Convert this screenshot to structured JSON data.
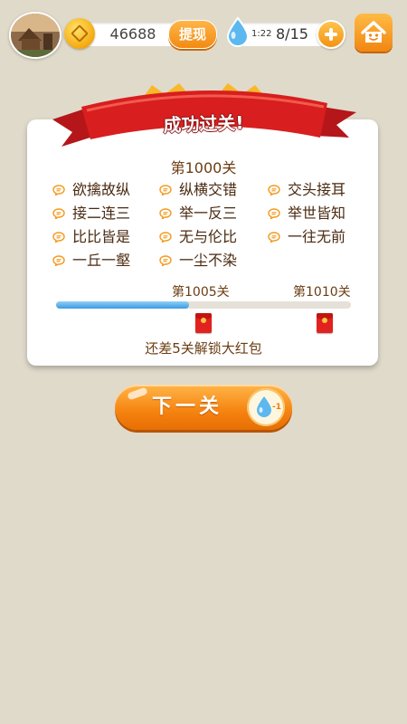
{
  "topbar": {
    "coins": "46688",
    "withdraw_label": "提现",
    "drop_timer": "1:22",
    "drop_count": "8/15"
  },
  "result": {
    "banner_title": "成功过关!",
    "level_title": "第1000关",
    "idioms": [
      [
        "欲擒故纵",
        "纵横交错",
        "交头接耳"
      ],
      [
        "接二连三",
        "举一反三",
        "举世皆知"
      ],
      [
        "比比皆是",
        "无与伦比",
        "一往无前"
      ],
      [
        "一丘一壑",
        "一尘不染"
      ]
    ]
  },
  "progress": {
    "start_label": "第1005关",
    "end_label": "第1010关",
    "fill_fraction": 0.45,
    "unlock_text": "还差5关解锁大红包"
  },
  "next": {
    "label": "下一关",
    "cost": "-1"
  },
  "colors": {
    "background": "#e0dacb",
    "accent_orange": "#f5830f",
    "ribbon_red": "#d81e1e",
    "progress_blue": "#3c9be0"
  }
}
